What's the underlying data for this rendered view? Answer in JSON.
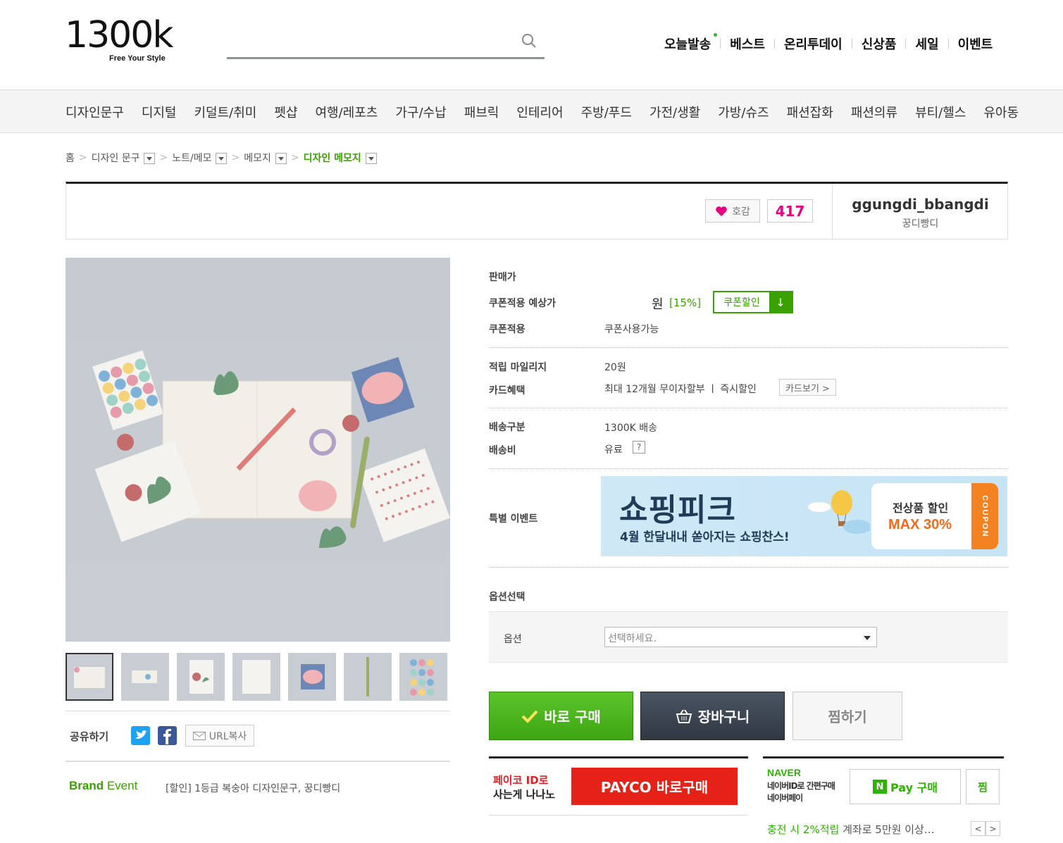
{
  "logo": {
    "main": "1300k",
    "tagline": "Free Your Style"
  },
  "search": {
    "placeholder": ""
  },
  "top_nav": [
    {
      "label": "오늘발송",
      "dot": true
    },
    {
      "label": "베스트"
    },
    {
      "label": "온리투데이"
    },
    {
      "label": "신상품"
    },
    {
      "label": "세일"
    },
    {
      "label": "이벤트"
    }
  ],
  "categories": [
    "디자인문구",
    "디지털",
    "키덜트/취미",
    "펫샵",
    "여행/레포츠",
    "가구/수납",
    "패브릭",
    "인테리어",
    "주방/푸드",
    "가전/생활",
    "가방/슈즈",
    "패션잡화",
    "패션의류",
    "뷰티/헬스",
    "유아동"
  ],
  "breadcrumb": {
    "home": "홈",
    "items": [
      "디자인 문구",
      "노트/메모",
      "메모지"
    ],
    "current": "디자인 메모지"
  },
  "product_header": {
    "like_label": "호감",
    "like_count": "417",
    "brand_en": "ggungdi_bbangdi",
    "brand_ko": "꿍디빵디"
  },
  "info": {
    "price_label": "판매가",
    "coupon_price_label": "쿠폰적용 예상가",
    "coupon_price_value": "원",
    "coupon_pct": "[15%]",
    "coupon_btn": "쿠폰할인",
    "coupon_apply_label": "쿠폰적용",
    "coupon_apply_value": "쿠폰사용가능",
    "mileage_label": "적립 마일리지",
    "mileage_value": "20원",
    "card_label": "카드혜택",
    "card_value": "최대 12개월 무이자할부 ㅣ 즉시할인",
    "card_btn": "카드보기 >",
    "ship_type_label": "배송구분",
    "ship_type_value": "1300K 배송",
    "ship_fee_label": "배송비",
    "ship_fee_value": "유료",
    "ship_fee_help": "?",
    "event_label": "특별 이벤트",
    "option_section": "옵션선택",
    "option_label": "옵션",
    "option_select": "선택하세요."
  },
  "banner": {
    "title": "쇼핑피크",
    "subtitle": "4월 한달내내 쏟아지는 쇼핑찬스!",
    "coupon_line1": "전상품 할인",
    "coupon_line2": "MAX 30%",
    "coupon_tag": "COUPON"
  },
  "actions": {
    "buy": "바로 구매",
    "cart": "장바구니",
    "wish": "찜하기"
  },
  "payco": {
    "text_red": "페이코 ID로",
    "text_black": "사는게 나나노",
    "button": "PAYCO 바로구매"
  },
  "naver": {
    "logo": "NAVER",
    "line1": "네이버ID로 간편구매",
    "line2": "네이버페이",
    "pay_btn": "Pay 구매",
    "zzim": "찜",
    "promo_green": "충전 시 2%적립",
    "promo_text": "계좌로 5만원 이상…"
  },
  "share": {
    "label": "공유하기",
    "url_btn": "URL복사"
  },
  "brand_event": {
    "title_1": "Brand",
    "title_2": " Event",
    "text": "[할인] 1등급 복숭아 디자인문구, 꿍디빵디"
  },
  "colors": {
    "accent_green": "#39a100",
    "pink": "#e6007e",
    "payco_red": "#e62117",
    "naver_green": "#2db400"
  }
}
